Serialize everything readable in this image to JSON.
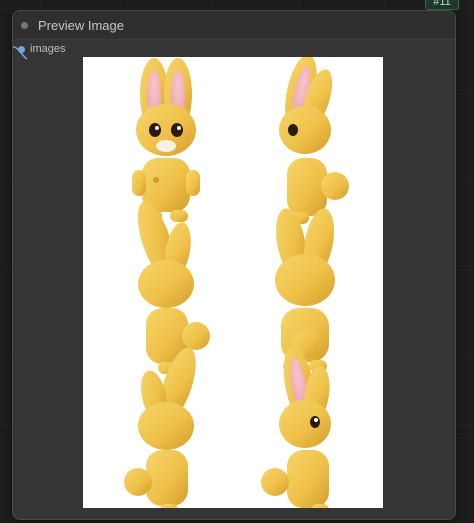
{
  "node": {
    "id_tag": "#11",
    "title": "Preview Image",
    "input_label": "images"
  },
  "preview": {
    "rows": 3,
    "cols": 2,
    "subject": "rabbit"
  },
  "colors": {
    "canvas_bg": "#1d1d1d",
    "node_bg": "#353535",
    "header_bg": "#2f2f2f",
    "slot": "#72a5e0",
    "rabbit_body": "#f2c64a",
    "rabbit_shadow": "#d7a42d",
    "rabbit_ear_inner": "#f2b2bb",
    "eye": "#2a1a11",
    "line": "#1d1d1d"
  }
}
